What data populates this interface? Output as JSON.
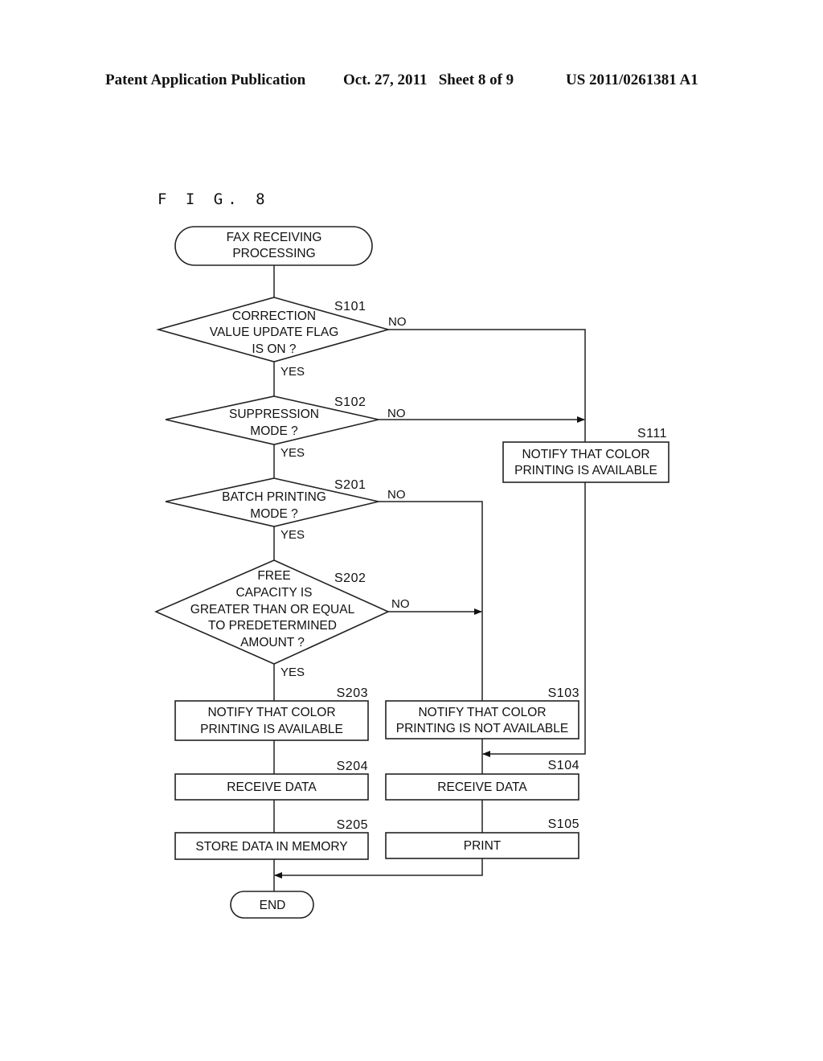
{
  "header": {
    "publication": "Patent Application Publication",
    "date_sheet": "Oct. 27, 2011   Sheet 8 of 9",
    "patent_number": "US 2011/0261381 A1"
  },
  "figure": {
    "label": "F I G. 8",
    "start": {
      "lines": [
        "FAX RECEIVING",
        "PROCESSING"
      ]
    },
    "end": {
      "lines": [
        "END"
      ]
    },
    "decisions": [
      {
        "id": "S101",
        "lines": [
          "CORRECTION",
          "VALUE UPDATE FLAG",
          "IS ON ?"
        ],
        "yes": "YES",
        "no": "NO"
      },
      {
        "id": "S102",
        "lines": [
          "SUPPRESSION",
          "MODE ?"
        ],
        "yes": "YES",
        "no": "NO"
      },
      {
        "id": "S201",
        "lines": [
          "BATCH PRINTING",
          "MODE ?"
        ],
        "yes": "YES",
        "no": "NO"
      },
      {
        "id": "S202",
        "lines": [
          "FREE",
          "CAPACITY IS",
          "GREATER THAN OR EQUAL",
          "TO PREDETERMINED",
          "AMOUNT ?"
        ],
        "yes": "YES",
        "no": "NO"
      }
    ],
    "processes": [
      {
        "id": "S111",
        "lines": [
          "NOTIFY THAT COLOR",
          "PRINTING IS AVAILABLE"
        ]
      },
      {
        "id": "S203",
        "lines": [
          "NOTIFY THAT COLOR",
          "PRINTING IS AVAILABLE"
        ]
      },
      {
        "id": "S103",
        "lines": [
          "NOTIFY THAT COLOR",
          "PRINTING IS NOT AVAILABLE"
        ]
      },
      {
        "id": "S204",
        "lines": [
          "RECEIVE DATA"
        ]
      },
      {
        "id": "S104",
        "lines": [
          "RECEIVE DATA"
        ]
      },
      {
        "id": "S205",
        "lines": [
          "STORE DATA IN MEMORY"
        ]
      },
      {
        "id": "S105",
        "lines": [
          "PRINT"
        ]
      }
    ]
  }
}
